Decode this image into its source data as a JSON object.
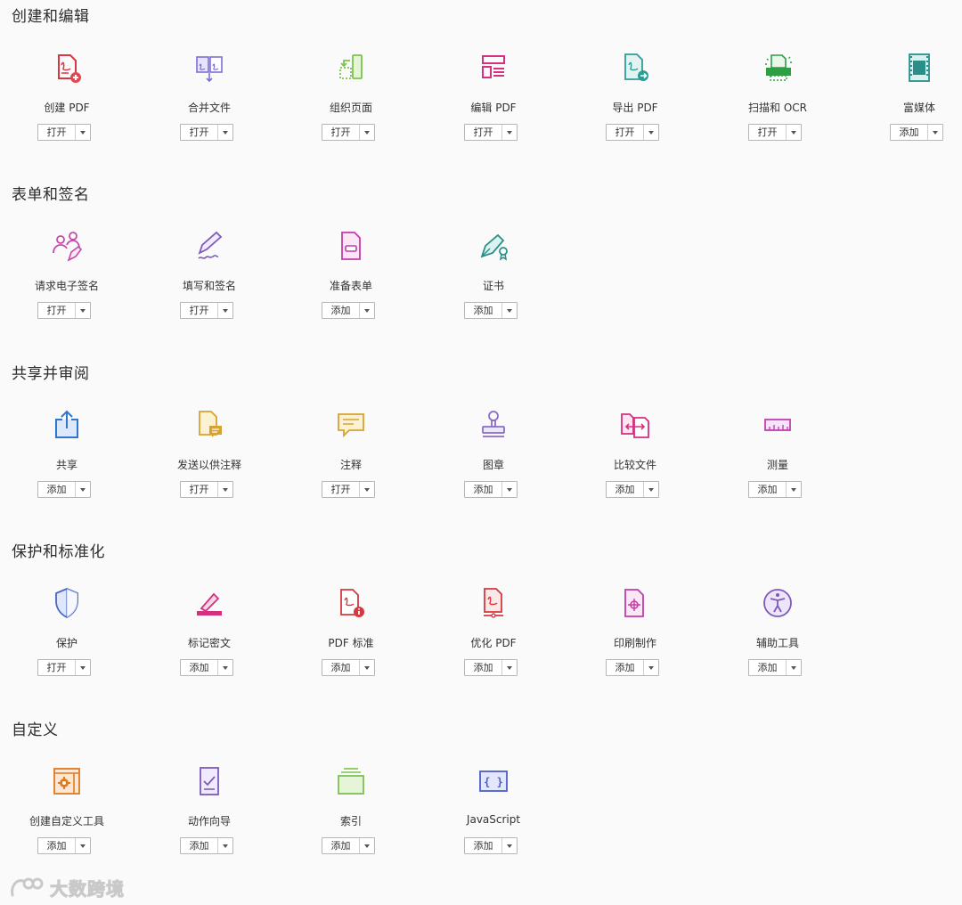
{
  "sections": [
    {
      "title": "创建和编辑",
      "tools": [
        {
          "label": "创建 PDF",
          "button": "打开",
          "icon": "create-pdf-icon"
        },
        {
          "label": "合并文件",
          "button": "打开",
          "icon": "combine-files-icon"
        },
        {
          "label": "组织页面",
          "button": "打开",
          "icon": "organize-pages-icon"
        },
        {
          "label": "编辑 PDF",
          "button": "打开",
          "icon": "edit-pdf-icon"
        },
        {
          "label": "导出 PDF",
          "button": "打开",
          "icon": "export-pdf-icon"
        },
        {
          "label": "扫描和 OCR",
          "button": "打开",
          "icon": "scan-ocr-icon"
        },
        {
          "label": "富媒体",
          "button": "添加",
          "icon": "rich-media-icon"
        }
      ]
    },
    {
      "title": "表单和签名",
      "tools": [
        {
          "label": "请求电子签名",
          "button": "打开",
          "icon": "request-signatures-icon"
        },
        {
          "label": "填写和签名",
          "button": "打开",
          "icon": "fill-sign-icon"
        },
        {
          "label": "准备表单",
          "button": "添加",
          "icon": "prepare-form-icon"
        },
        {
          "label": "证书",
          "button": "添加",
          "icon": "certificates-icon"
        }
      ]
    },
    {
      "title": "共享并审阅",
      "tools": [
        {
          "label": "共享",
          "button": "添加",
          "icon": "share-icon"
        },
        {
          "label": "发送以供注释",
          "button": "打开",
          "icon": "send-for-comments-icon"
        },
        {
          "label": "注释",
          "button": "打开",
          "icon": "comment-icon"
        },
        {
          "label": "图章",
          "button": "添加",
          "icon": "stamp-icon"
        },
        {
          "label": "比较文件",
          "button": "添加",
          "icon": "compare-files-icon"
        },
        {
          "label": "测量",
          "button": "添加",
          "icon": "measure-icon"
        }
      ]
    },
    {
      "title": "保护和标准化",
      "tools": [
        {
          "label": "保护",
          "button": "打开",
          "icon": "protect-icon"
        },
        {
          "label": "标记密文",
          "button": "添加",
          "icon": "redact-icon"
        },
        {
          "label": "PDF 标准",
          "button": "添加",
          "icon": "pdf-standards-icon"
        },
        {
          "label": "优化 PDF",
          "button": "添加",
          "icon": "optimize-pdf-icon"
        },
        {
          "label": "印刷制作",
          "button": "添加",
          "icon": "print-production-icon"
        },
        {
          "label": "辅助工具",
          "button": "添加",
          "icon": "accessibility-icon"
        }
      ]
    },
    {
      "title": "自定义",
      "tools": [
        {
          "label": "创建自定义工具",
          "button": "添加",
          "icon": "create-custom-tool-icon"
        },
        {
          "label": "动作向导",
          "button": "添加",
          "icon": "action-wizard-icon"
        },
        {
          "label": "索引",
          "button": "添加",
          "icon": "index-icon"
        },
        {
          "label": "JavaScript",
          "button": "添加",
          "icon": "javascript-icon"
        }
      ]
    }
  ],
  "watermark": {
    "text": "大数跨境",
    "icon": "logo-icon"
  }
}
